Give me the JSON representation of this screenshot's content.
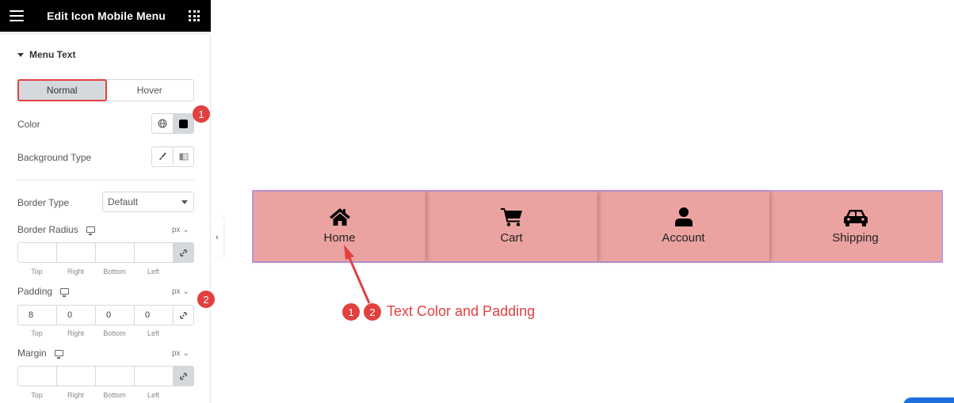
{
  "panel": {
    "title": "Edit Icon Mobile Menu",
    "section_title": "Menu Text",
    "tabs": [
      {
        "label": "Normal",
        "active": true
      },
      {
        "label": "Hover",
        "active": false
      }
    ],
    "color_label": "Color",
    "background_type_label": "Background Type",
    "border_type_label": "Border Type",
    "border_type_value": "Default",
    "border_radius_label": "Border Radius",
    "padding_label": "Padding",
    "margin_label": "Margin",
    "unit": "px",
    "dim_labels": [
      "Top",
      "Right",
      "Bottom",
      "Left"
    ],
    "border_radius_values": [
      "",
      "",
      "",
      ""
    ],
    "padding_values": [
      "8",
      "0",
      "0",
      "0"
    ],
    "margin_values": [
      "",
      "",
      "",
      ""
    ],
    "collapse_icon": "chevron-left-icon"
  },
  "menu": {
    "items": [
      {
        "label": "Home",
        "icon": "home-icon"
      },
      {
        "label": "Cart",
        "icon": "cart-icon"
      },
      {
        "label": "Account",
        "icon": "user-icon"
      },
      {
        "label": "Shipping",
        "icon": "car-icon"
      }
    ],
    "background": "#eba3a1",
    "border": "#c39ad8"
  },
  "annotation": {
    "badges": [
      "1",
      "2"
    ],
    "text": "Text Color and Padding",
    "color": "#e2403f"
  }
}
